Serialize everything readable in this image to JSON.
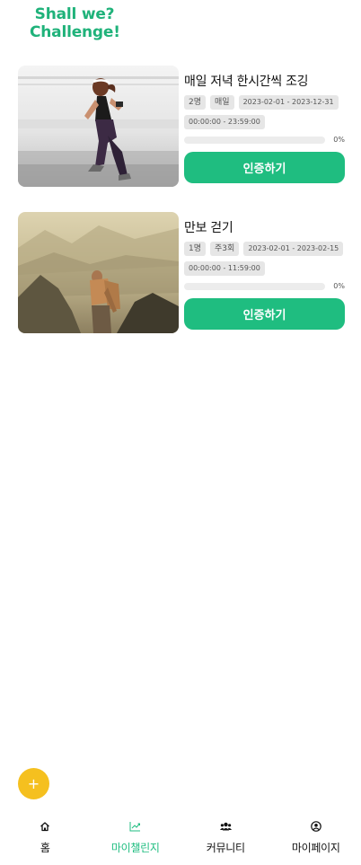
{
  "app": {
    "logo_line1": "Shall we?",
    "logo_line2": "Challenge!"
  },
  "challenges": [
    {
      "title": "매일 저녁 한시간씩 조깅",
      "members": "2명",
      "frequency": "매일",
      "period": "2023-02-01 - 2023-12-31",
      "time": "00:00:00 - 23:59:00",
      "progress": 0,
      "progress_label": "0%",
      "button": "인증하기"
    },
    {
      "title": "만보 걷기",
      "members": "1명",
      "frequency": "주3회",
      "period": "2023-02-01 - 2023-02-15",
      "time": "00:00:00 - 11:59:00",
      "progress": 0,
      "progress_label": "0%",
      "button": "인증하기"
    }
  ],
  "fab": {
    "label": "+"
  },
  "nav": {
    "items": [
      {
        "label": "홈",
        "icon": "home-icon"
      },
      {
        "label": "마이챌린지",
        "icon": "trend-chart-icon"
      },
      {
        "label": "커뮤니티",
        "icon": "users-icon"
      },
      {
        "label": "마이페이지",
        "icon": "user-circle-icon"
      }
    ],
    "active_index": 1
  },
  "colors": {
    "brand": "#1fbd80",
    "fab": "#f5c01f",
    "tag_bg": "#e6e6e6"
  }
}
